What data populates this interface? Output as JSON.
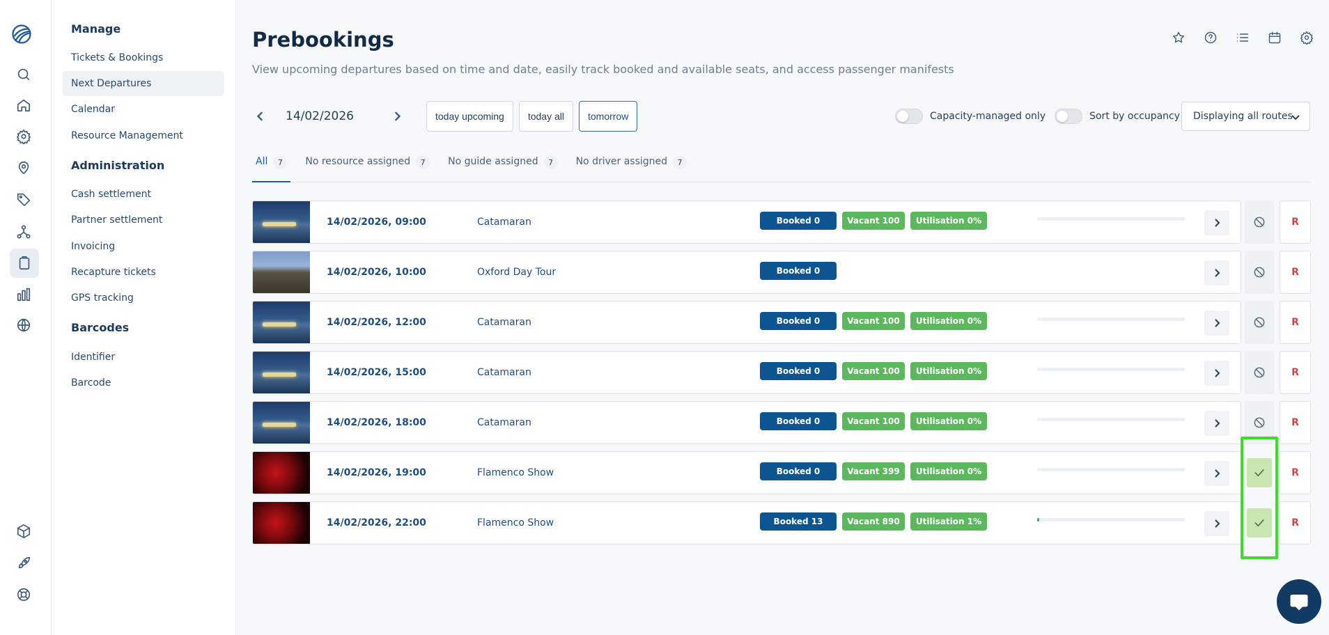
{
  "rail": {
    "icons": [
      "logo-icon",
      "search-icon",
      "home-icon",
      "gear-icon",
      "location-user-icon",
      "tag-icon",
      "network-icon",
      "clipboard-icon",
      "bar-chart-icon",
      "globe-icon",
      "cube-icon",
      "rocket-icon",
      "lifebuoy-icon"
    ],
    "active": "clipboard-icon"
  },
  "menu": {
    "manage": {
      "title": "Manage",
      "items": [
        "Tickets & Bookings",
        "Next Departures",
        "Calendar",
        "Resource Management"
      ]
    },
    "administration": {
      "title": "Administration",
      "items": [
        "Cash settlement",
        "Partner settlement",
        "Invoicing",
        "Recapture tickets",
        "GPS tracking"
      ]
    },
    "barcodes": {
      "title": "Barcodes",
      "items": [
        "Identifier",
        "Barcode"
      ]
    },
    "active_item": "Next Departures"
  },
  "page": {
    "title": "Prebookings",
    "subtitle": "View upcoming departures based on time and date, easily track booked and available seats, and access passenger manifests",
    "header_icons": [
      "star-icon",
      "help-icon",
      "list-icon",
      "calendar-icon",
      "gear-icon"
    ]
  },
  "date_nav": {
    "date": "14/02/2026",
    "quick": [
      "today upcoming",
      "today all",
      "tomorrow"
    ],
    "selected": "tomorrow"
  },
  "filters": {
    "capacity_label": "Capacity-managed only",
    "sort_label": "Sort by occupancy",
    "routes_label": "Displaying all routes"
  },
  "tabs": [
    {
      "label": "All",
      "count": "7"
    },
    {
      "label": "No resource assigned",
      "count": "7"
    },
    {
      "label": "No guide assigned",
      "count": "7"
    },
    {
      "label": "No driver assigned",
      "count": "7"
    }
  ],
  "departures": [
    {
      "time": "14/02/2026, 09:00",
      "name": "Catamaran",
      "booked": "Booked 0",
      "vacant": "Vacant 100",
      "utilisation": "Utilisation 0%",
      "utilisation_fraction": 0,
      "status": "disabled",
      "image": "boat"
    },
    {
      "time": "14/02/2026, 10:00",
      "name": "Oxford Day Tour",
      "booked": "Booked 0",
      "vacant": null,
      "utilisation": null,
      "utilisation_fraction": null,
      "status": "disabled",
      "image": "oxford"
    },
    {
      "time": "14/02/2026, 12:00",
      "name": "Catamaran",
      "booked": "Booked 0",
      "vacant": "Vacant 100",
      "utilisation": "Utilisation 0%",
      "utilisation_fraction": 0,
      "status": "disabled",
      "image": "boat"
    },
    {
      "time": "14/02/2026, 15:00",
      "name": "Catamaran",
      "booked": "Booked 0",
      "vacant": "Vacant 100",
      "utilisation": "Utilisation 0%",
      "utilisation_fraction": 0,
      "status": "disabled",
      "image": "boat"
    },
    {
      "time": "14/02/2026, 18:00",
      "name": "Catamaran",
      "booked": "Booked 0",
      "vacant": "Vacant 100",
      "utilisation": "Utilisation 0%",
      "utilisation_fraction": 0,
      "status": "disabled",
      "image": "boat"
    },
    {
      "time": "14/02/2026, 19:00",
      "name": "Flamenco Show",
      "booked": "Booked 0",
      "vacant": "Vacant 399",
      "utilisation": "Utilisation 0%",
      "utilisation_fraction": 0,
      "status": "confirmed",
      "image": "flamenco"
    },
    {
      "time": "14/02/2026, 22:00",
      "name": "Flamenco Show",
      "booked": "Booked 13",
      "vacant": "Vacant 890",
      "utilisation": "Utilisation 1%",
      "utilisation_fraction": 0.014,
      "status": "confirmed",
      "image": "flamenco"
    }
  ],
  "row_action_label": "R",
  "colors": {
    "brand": "#0c5590",
    "success": "#5cb85c",
    "confirm_bg": "#c9e6b0",
    "highlight": "#37e022",
    "danger": "#e04040"
  }
}
